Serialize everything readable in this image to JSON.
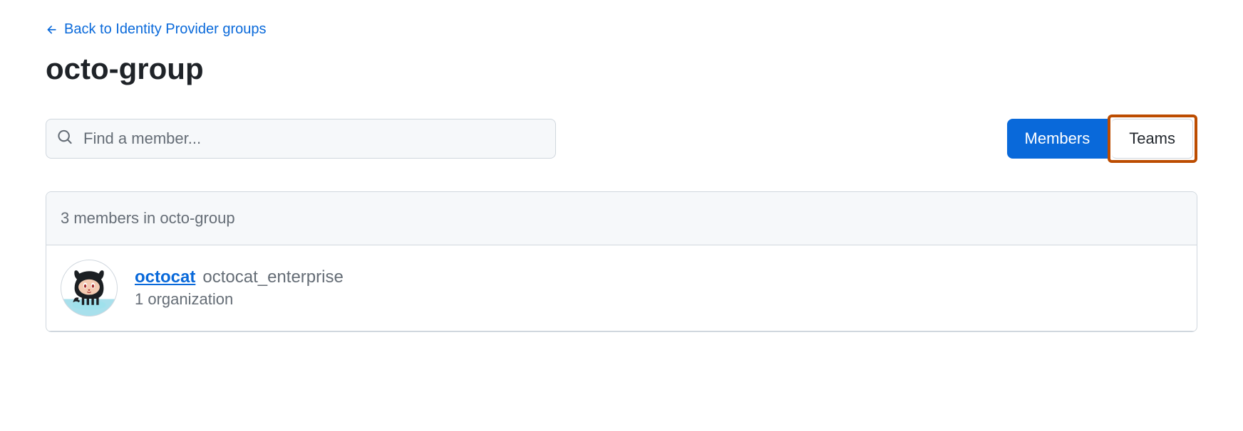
{
  "back_link": {
    "label": "Back to Identity Provider groups"
  },
  "page_title": "octo-group",
  "search": {
    "placeholder": "Find a member..."
  },
  "tabs": {
    "members_label": "Members",
    "teams_label": "Teams"
  },
  "list": {
    "header": "3 members in octo-group",
    "items": [
      {
        "name": "octocat",
        "handle": "octocat_enterprise",
        "meta": "1 organization"
      }
    ]
  }
}
